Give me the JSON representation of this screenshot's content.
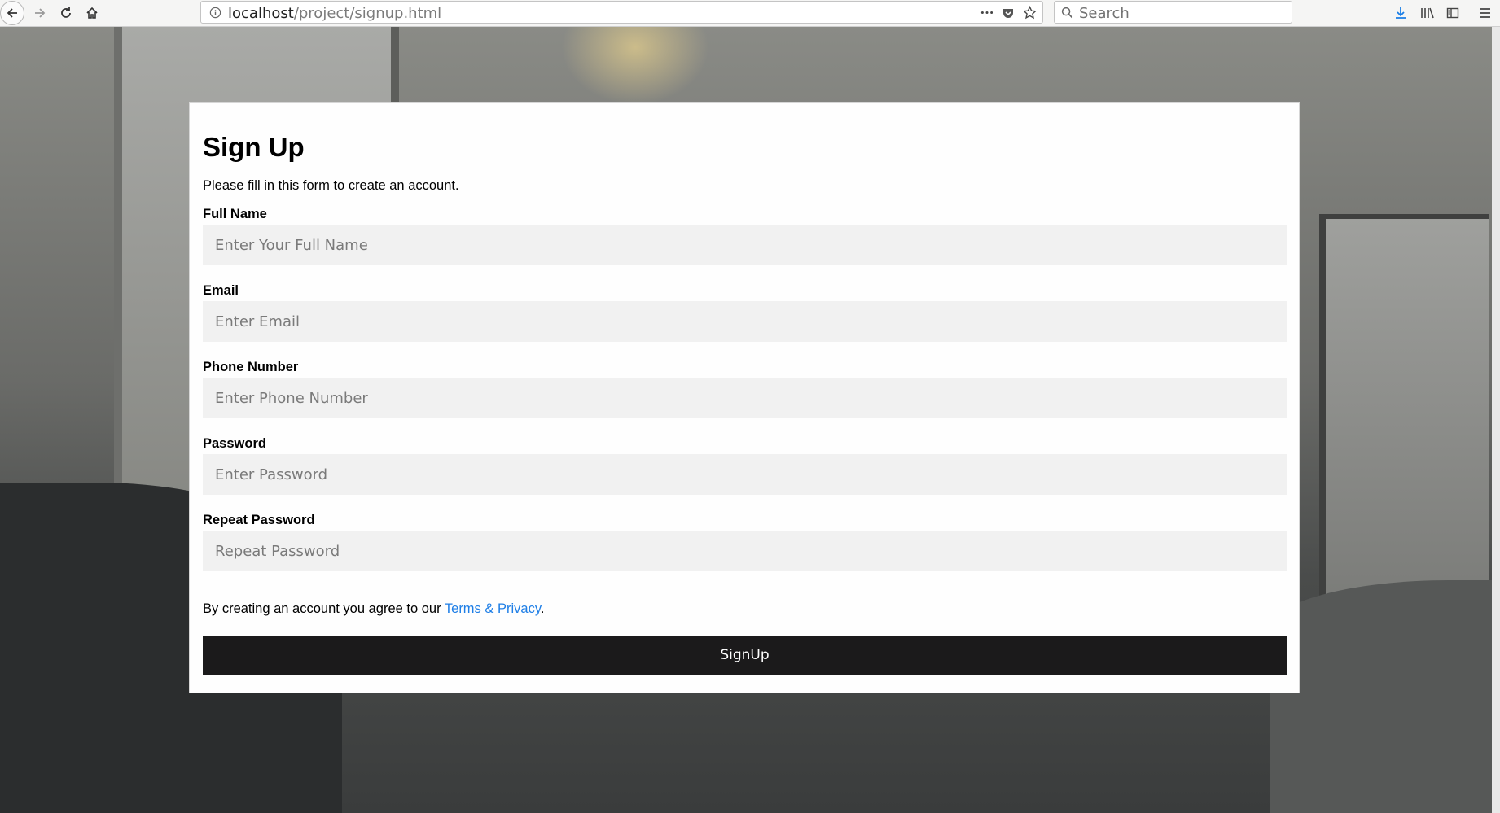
{
  "browser": {
    "url_host": "localhost",
    "url_path": "/project/signup.html",
    "search_placeholder": "Search"
  },
  "form": {
    "title": "Sign Up",
    "subtitle": "Please fill in this form to create an account.",
    "fields": [
      {
        "label": "Full Name",
        "placeholder": "Enter Your Full Name"
      },
      {
        "label": "Email",
        "placeholder": "Enter Email"
      },
      {
        "label": "Phone Number",
        "placeholder": "Enter Phone Number"
      },
      {
        "label": "Password",
        "placeholder": "Enter Password"
      },
      {
        "label": "Repeat Password",
        "placeholder": "Repeat Password"
      }
    ],
    "terms_prefix": "By creating an account you agree to our ",
    "terms_link": "Terms & Privacy",
    "terms_suffix": ".",
    "submit_label": "SignUp"
  },
  "colors": {
    "link": "#1e7ee6",
    "button_bg": "#1b1a1b",
    "input_bg": "#f1f1f1"
  }
}
